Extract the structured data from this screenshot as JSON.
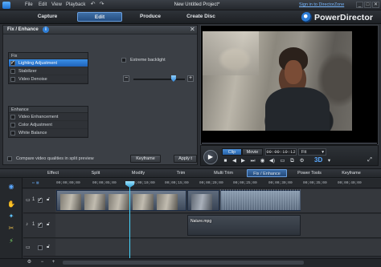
{
  "menu": {
    "items": [
      "File",
      "Edit",
      "View",
      "Playback"
    ]
  },
  "title_bar": {
    "doc_title": "New Untitled Project*",
    "signin": "Sign in to DirectorZone",
    "min": "_",
    "max": "□",
    "close": "✕"
  },
  "mode_tabs": [
    "Capture",
    "Edit",
    "Produce",
    "Create Disc"
  ],
  "brand": "PowerDirector",
  "panel": {
    "title": "Fix / Enhance",
    "info": "i",
    "close": "✕",
    "fix_header": "Fix",
    "fix_items": [
      "Lighting Adjustment",
      "Stabilizer",
      "Video Denoise"
    ],
    "enhance_header": "Enhance",
    "enhance_items": [
      "Video Enhancement",
      "Color Adjustment",
      "White Balance"
    ],
    "extreme_backlight": "Extreme backlight",
    "slider_minus": "−",
    "slider_plus": "+",
    "slider_level": 0.78,
    "compare_label": "Compare video qualities in split preview",
    "keyframe_btn": "Keyframe",
    "apply_btn": "Apply t"
  },
  "preview": {
    "clip_btn": "Clip",
    "movie_btn": "Movie",
    "timecode": "00:00:10:12",
    "fit": "Fit",
    "three_d": "3D",
    "play": "▶",
    "expand": "⤢"
  },
  "tool_tabs": [
    "Effect",
    "Split",
    "Modify",
    "Trim",
    "Multi Trim",
    "Fix / Enhance",
    "Power Tools",
    "Keyframe"
  ],
  "timeline": {
    "ticks": [
      "00;00;00;00",
      "00;00;05;00",
      "00;00;10;00",
      "00;00;15;00",
      "00;00;20;00",
      "00;00;25;00",
      "00;00;30;00",
      "00;00;35;00",
      "00;00;40;00"
    ],
    "track1_num": "1",
    "track2_num": "1",
    "audio_clip_label": "Nature.mpg"
  },
  "colors": {
    "accent": "#2f86da",
    "playhead": "#45d6ff",
    "brand_blue": "#59a9ff"
  }
}
